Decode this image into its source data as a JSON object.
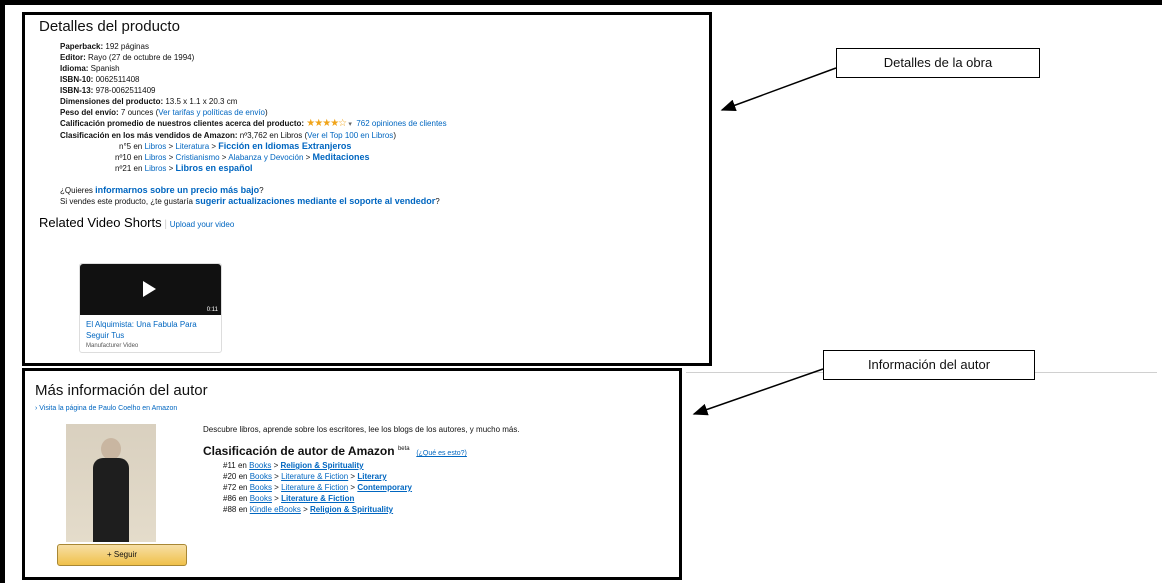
{
  "details": {
    "title": "Detalles del producto",
    "paperback_label": "Paperback:",
    "paperback_value": " 192 páginas",
    "publisher_label": "Editor:",
    "publisher_value": " Rayo (27 de octubre de 1994)",
    "language_label": "Idioma:",
    "language_value": " Spanish",
    "isbn10_label": "ISBN-10:",
    "isbn10_value": " 0062511408",
    "isbn13_label": "ISBN-13:",
    "isbn13_value": " 978-0062511409",
    "dimensions_label": "Dimensiones del producto:",
    "dimensions_value": " 13.5 x 1.1 x 20.3 cm",
    "weight_label": "Peso del envío:",
    "weight_value": " 7 ounces (",
    "weight_link": "Ver tarifas y políticas de envío",
    "weight_close": ")",
    "rating_label": "Calificación promedio de nuestros clientes acerca del producto:",
    "rating_stars": "★★★★☆",
    "rating_caret": "▾",
    "reviews_link": "762 opiniones de clientes",
    "bestseller_label": "Clasificación en los más vendidos de Amazon:",
    "bestseller_value": " nº3,762 en Libros (",
    "top100_link": "Ver el Top 100 en Libros",
    "bestseller_close": ")",
    "ranks": [
      {
        "pos": "n°5 en ",
        "cat1": "Libros",
        "sep1": " > ",
        "cat2": "Literatura",
        "sep2": " > ",
        "cat3": "Ficción en Idiomas Extranjeros"
      },
      {
        "pos": "nº10 en ",
        "cat1": "Libros",
        "sep1": " > ",
        "cat2": "Cristianismo",
        "sep2": " > ",
        "cat3": "Alabanza y Devoción",
        "sep3": " > ",
        "cat4": "Meditaciones"
      },
      {
        "pos": "nº21 en ",
        "cat1": "Libros",
        "sep1": " > ",
        "cat2": "Libros en español"
      }
    ],
    "price_text": "¿Quieres ",
    "price_link": "informarnos sobre un precio más bajo",
    "price_end": "?",
    "seller_text": "Si vendes este producto, ¿te gustaría ",
    "seller_link": "sugerir actualizaciones mediante el soporte al vendedor",
    "seller_end": "?"
  },
  "shorts": {
    "title": "Related Video Shorts",
    "separator": " | ",
    "upload_link": "Upload your video",
    "video_duration": "0:11",
    "video_title": "El Alquimista: Una Fabula Para Seguir Tus",
    "video_source": "Manufacturer Video"
  },
  "author": {
    "title": "Más información del autor",
    "visit_link": "› Visita la página de Paulo Coelho en Amazon",
    "discover_text": "Descubre libros, aprende sobre los escritores, lee los blogs de los autores, y mucho más.",
    "rank_title": "Clasificación de autor de Amazon",
    "beta": "beta",
    "what_link": "(¿Qué es esto?)",
    "ranks": [
      {
        "pos": "#11 en ",
        "store": "Books",
        "sep1": " > ",
        "c1": "Religion & Spirituality"
      },
      {
        "pos": "#20 en ",
        "store": "Books",
        "sep1": " > ",
        "c1": "Literature & Fiction",
        "sep2": " > ",
        "c2": "Literary"
      },
      {
        "pos": "#72 en ",
        "store": "Books",
        "sep1": " > ",
        "c1": "Literature & Fiction",
        "sep2": " > ",
        "c2": "Contemporary"
      },
      {
        "pos": "#86 en ",
        "store": "Books",
        "sep1": " > ",
        "c1": "Literature & Fiction"
      },
      {
        "pos": "#88 en ",
        "store": "Kindle eBooks",
        "sep1": " > ",
        "c1": "Religion & Spirituality"
      }
    ],
    "follow_button": "+ Seguir"
  },
  "callouts": {
    "work_details": "Detalles de la obra",
    "author_info": "Información del autor"
  },
  "colors": {
    "link": "#0066c0",
    "star": "#f0a41a",
    "button": "#f0c14b"
  }
}
